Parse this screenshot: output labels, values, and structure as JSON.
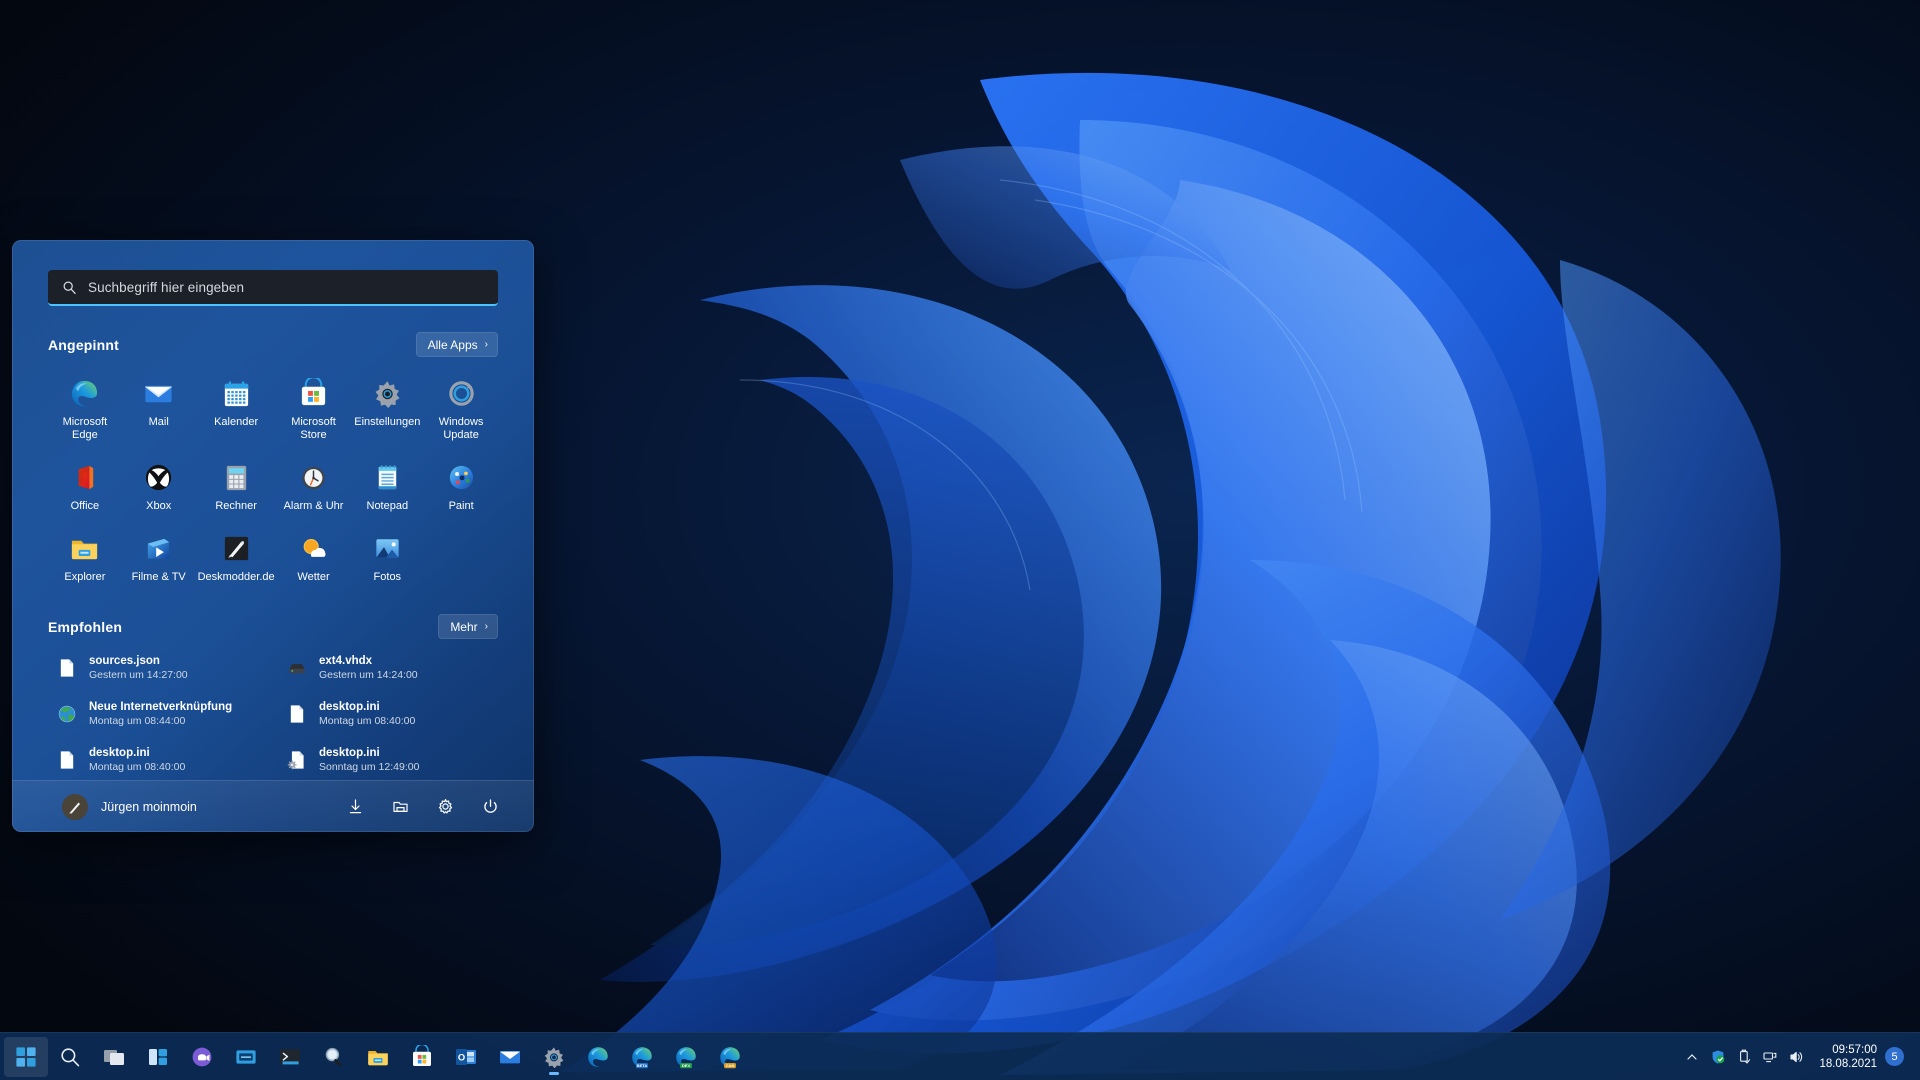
{
  "search": {
    "placeholder": "Suchbegriff hier eingeben",
    "icon": "search-icon"
  },
  "pinned": {
    "title": "Angepinnt",
    "all_apps_label": "Alle Apps",
    "all_apps_chevron": "›",
    "apps": [
      {
        "label": "Microsoft Edge",
        "icon": "edge-icon"
      },
      {
        "label": "Mail",
        "icon": "mail-icon"
      },
      {
        "label": "Kalender",
        "icon": "calendar-icon"
      },
      {
        "label": "Microsoft Store",
        "icon": "store-icon"
      },
      {
        "label": "Einstellungen",
        "icon": "settings-gear-icon"
      },
      {
        "label": "Windows Update",
        "icon": "windows-update-icon"
      },
      {
        "label": "Office",
        "icon": "office-icon"
      },
      {
        "label": "Xbox",
        "icon": "xbox-icon"
      },
      {
        "label": "Rechner",
        "icon": "calculator-icon"
      },
      {
        "label": "Alarm & Uhr",
        "icon": "alarm-clock-icon"
      },
      {
        "label": "Notepad",
        "icon": "notepad-icon"
      },
      {
        "label": "Paint",
        "icon": "paint-icon"
      },
      {
        "label": "Explorer",
        "icon": "folder-icon"
      },
      {
        "label": "Filme & TV",
        "icon": "movies-tv-icon"
      },
      {
        "label": "Deskmodder.de",
        "icon": "deskmodder-icon"
      },
      {
        "label": "Wetter",
        "icon": "weather-icon"
      },
      {
        "label": "Fotos",
        "icon": "photos-icon"
      }
    ]
  },
  "recommended": {
    "title": "Empfohlen",
    "more_label": "Mehr",
    "more_chevron": "›",
    "items": [
      {
        "name": "sources.json",
        "sub": "Gestern um 14:27:00",
        "icon": "file-generic-icon"
      },
      {
        "name": "ext4.vhdx",
        "sub": "Gestern um 14:24:00",
        "icon": "disk-icon"
      },
      {
        "name": "Neue Internetverknüpfung",
        "sub": "Montag um 08:44:00",
        "icon": "globe-icon"
      },
      {
        "name": "desktop.ini",
        "sub": "Montag um 08:40:00",
        "icon": "file-generic-icon"
      },
      {
        "name": "desktop.ini",
        "sub": "Montag um 08:40:00",
        "icon": "file-generic-icon"
      },
      {
        "name": "desktop.ini",
        "sub": "Sonntag um 12:49:00",
        "icon": "file-config-icon"
      }
    ]
  },
  "user_bar": {
    "name": "Jürgen moinmoin",
    "avatar_icon": "brush-avatar-icon",
    "actions": [
      {
        "icon": "downloads-icon"
      },
      {
        "icon": "documents-folder-icon"
      },
      {
        "icon": "settings-gear-icon"
      },
      {
        "icon": "power-icon"
      }
    ]
  },
  "taskbar": {
    "items": [
      {
        "icon": "start-windows-icon",
        "active": true,
        "running": false
      },
      {
        "icon": "search-icon",
        "active": false,
        "running": false
      },
      {
        "icon": "task-view-icon",
        "active": false,
        "running": false
      },
      {
        "icon": "widgets-icon",
        "active": false,
        "running": false
      },
      {
        "icon": "teams-chat-icon",
        "active": false,
        "running": false
      },
      {
        "icon": "terminal-window-icon",
        "active": false,
        "running": false
      },
      {
        "icon": "windows-terminal-icon",
        "active": false,
        "running": false
      },
      {
        "icon": "magnifier-tool-icon",
        "active": false,
        "running": false
      },
      {
        "icon": "file-explorer-icon",
        "active": false,
        "running": false
      },
      {
        "icon": "microsoft-store-icon",
        "active": false,
        "running": false
      },
      {
        "icon": "outlook-icon",
        "active": false,
        "running": false
      },
      {
        "icon": "mail-icon",
        "active": false,
        "running": false
      },
      {
        "icon": "settings-gear-icon",
        "active": false,
        "running": true
      },
      {
        "icon": "edge-icon",
        "active": false,
        "running": false
      },
      {
        "icon": "edge-beta-icon",
        "active": false,
        "running": false,
        "channel": "BETA"
      },
      {
        "icon": "edge-dev-icon",
        "active": false,
        "running": false,
        "channel": "DEV"
      },
      {
        "icon": "edge-canary-icon",
        "active": false,
        "running": false,
        "channel": "CAN"
      }
    ],
    "tray": [
      {
        "icon": "chevron-up-icon"
      },
      {
        "icon": "defender-shield-icon"
      },
      {
        "icon": "usb-eject-icon"
      },
      {
        "icon": "network-icon"
      },
      {
        "icon": "volume-icon"
      }
    ],
    "clock": {
      "time": "09:57:00",
      "date": "18.08.2021"
    },
    "notification_count": "5"
  },
  "colors": {
    "accent": "#4cc2ff",
    "menu_blue": "#1d4f92",
    "taskbar": "#0c2c56"
  }
}
